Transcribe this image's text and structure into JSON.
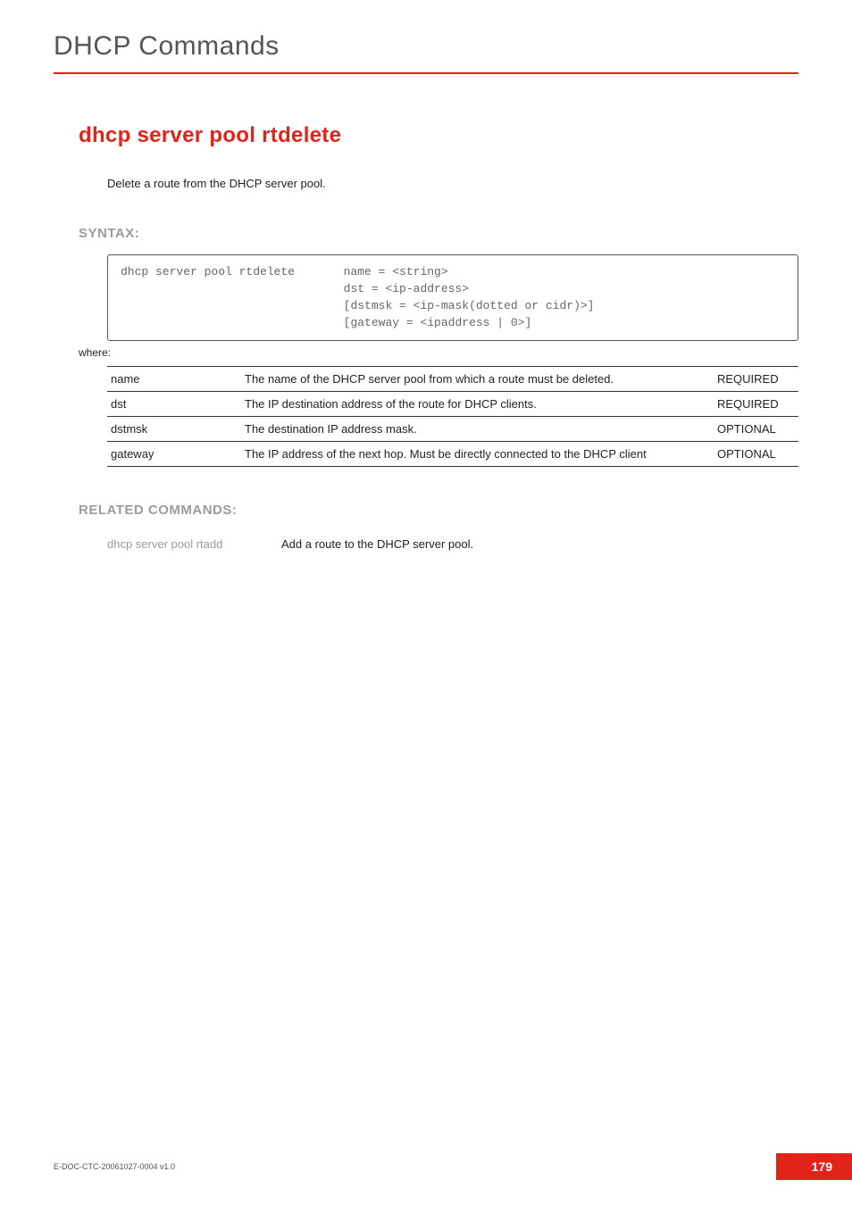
{
  "chapter": "DHCP Commands",
  "command_title": "dhcp server pool rtdelete",
  "command_description": "Delete a route from the DHCP server pool.",
  "syntax_label": "SYNTAX:",
  "syntax_text": "dhcp server pool rtdelete       name = <string>\n                                dst = <ip-address>\n                                [dstmsk = <ip-mask(dotted or cidr)>]\n                                [gateway = <ipaddress | 0>]",
  "where_label": "where:",
  "params": [
    {
      "name": "name",
      "desc": "The name of the DHCP server pool from which a route must be deleted.",
      "req": "REQUIRED"
    },
    {
      "name": "dst",
      "desc": "The IP destination address of the route for DHCP clients.",
      "req": "REQUIRED"
    },
    {
      "name": "dstmsk",
      "desc": "The destination IP address mask.",
      "req": "OPTIONAL"
    },
    {
      "name": "gateway",
      "desc": "The IP address of the next hop. Must be directly connected to the DHCP client",
      "req": "OPTIONAL"
    }
  ],
  "related_label": "RELATED COMMANDS:",
  "related": [
    {
      "cmd": "dhcp server pool rtadd",
      "desc": "Add a route to the DHCP server pool."
    }
  ],
  "footer": {
    "doc_id": "E-DOC-CTC-20061027-0004 v1.0",
    "page_number": "179"
  }
}
